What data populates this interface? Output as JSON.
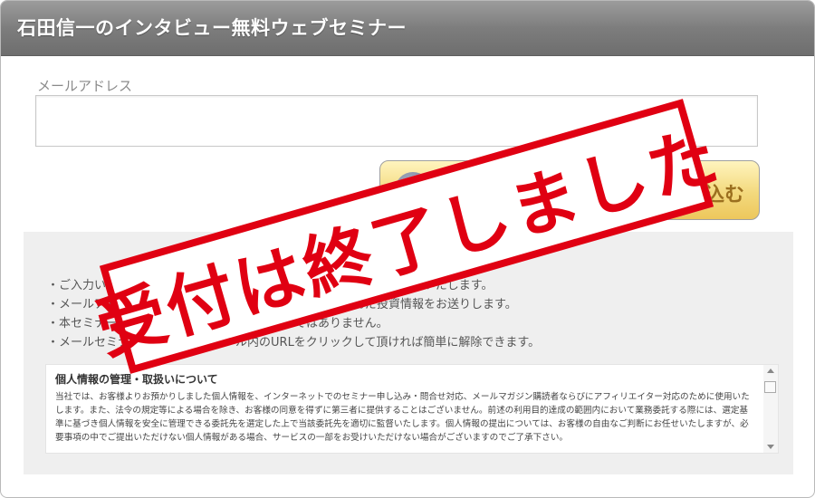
{
  "header": {
    "title": "石田信一のインタビュー無料ウェブセミナー"
  },
  "form": {
    "email_label": "メールアドレス",
    "email_value": "",
    "submit_label": "込む"
  },
  "notes": [
    "ご入力いただいたメールアドレスはプライバシーポリシーに則り管理いたします。",
    "メールアドレスをご登録いただいた方にはセミナーを含んだ投資情報をお送りします。",
    "本セミナーは特定の商品の購入を勧めるものではありません。",
    "メールセミナーは配信されるメール内のURLをクリックして頂ければ簡単に解除できます。"
  ],
  "privacy": {
    "heading": "個人情報の管理・取扱いについて",
    "body": "当社では、お客様よりお預かりしました個人情報を、インターネットでのセミナー申し込み・問合せ対応、メールマガジン購読者ならびにアフィリエイター対応のために使用いたします。また、法令の規定等による場合を除き、お客様の同意を得ずに第三者に提供することはございません。前述の利用目的達成の範囲内において業務委託する際には、選定基準に基づき個人情報を安全に管理できる委託先を選定した上で当該委託先を適切に監督いたします。個人情報の提出については、お客様の自由なご判断にお任せいたしますが、必要事項の中でご提出いただけない個人情報がある場合、サービスの一部をお受けいただけない場合がございますのでご了承下さい。"
  },
  "stamp": {
    "text": "受付は終了しました",
    "color": "#e00012"
  },
  "colors": {
    "header": "#7d7d7d",
    "button": "#f3d97d",
    "panel": "#efefef"
  }
}
